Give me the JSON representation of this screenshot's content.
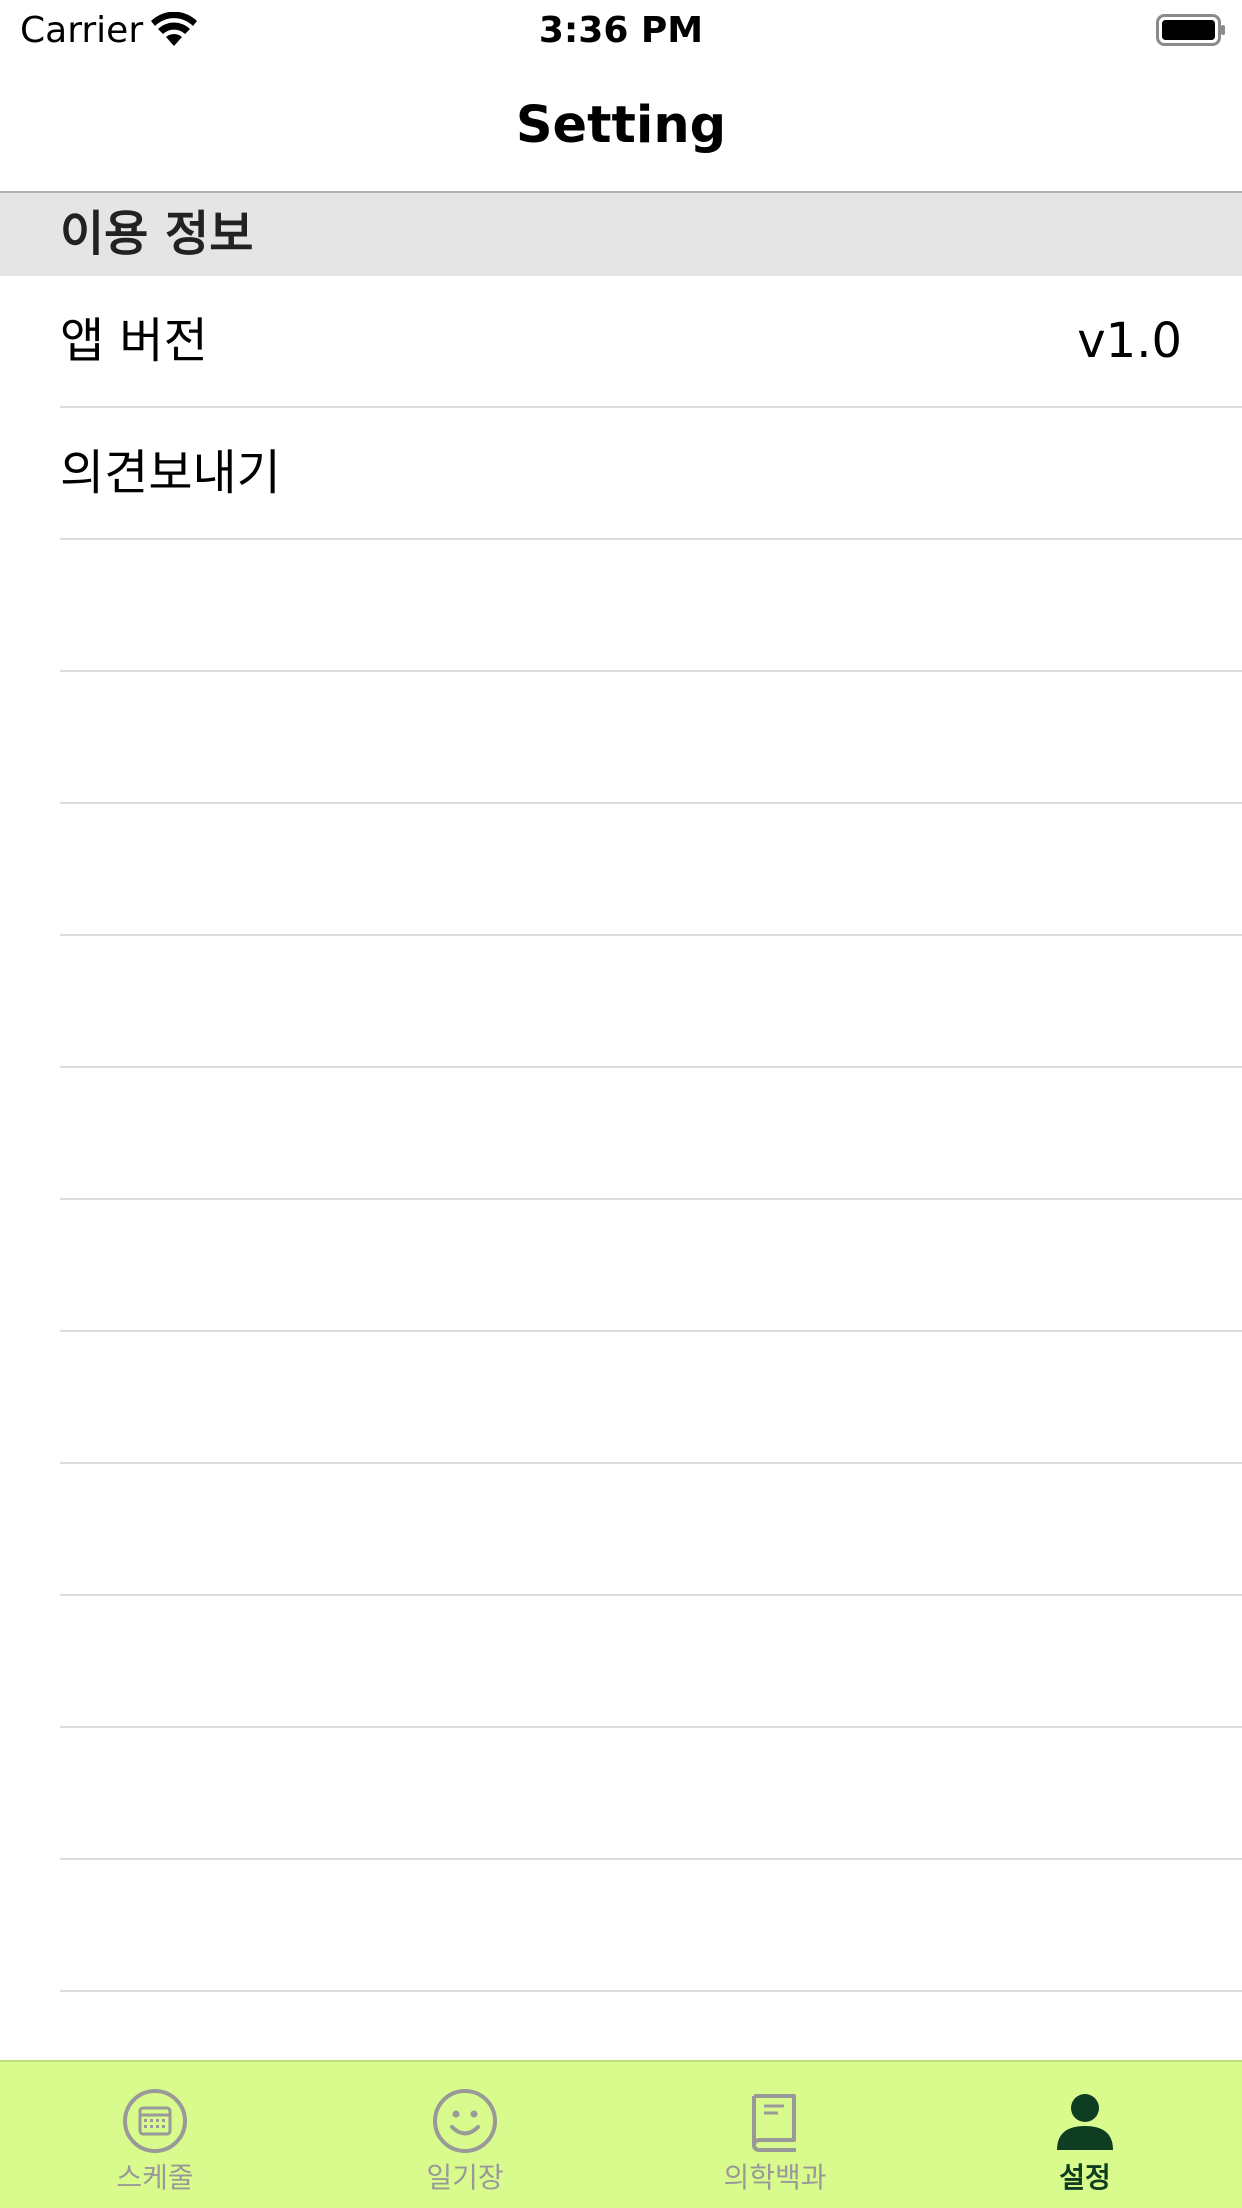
{
  "status_bar": {
    "carrier": "Carrier",
    "time": "3:36 PM"
  },
  "nav": {
    "title": "Setting"
  },
  "section": {
    "header": "이용 정보"
  },
  "rows": [
    {
      "label": "앱 버전",
      "detail": "v1.0"
    },
    {
      "label": "의견보내기",
      "detail": ""
    },
    {
      "label": "",
      "detail": ""
    },
    {
      "label": "",
      "detail": ""
    },
    {
      "label": "",
      "detail": ""
    },
    {
      "label": "",
      "detail": ""
    },
    {
      "label": "",
      "detail": ""
    },
    {
      "label": "",
      "detail": ""
    },
    {
      "label": "",
      "detail": ""
    },
    {
      "label": "",
      "detail": ""
    },
    {
      "label": "",
      "detail": ""
    },
    {
      "label": "",
      "detail": ""
    },
    {
      "label": "",
      "detail": ""
    },
    {
      "label": "",
      "detail": ""
    }
  ],
  "tab_bar": {
    "background": "#d9fa8c",
    "active_color": "#0f3d21",
    "inactive_color": "#999999",
    "tabs": [
      {
        "label": "스케줄",
        "icon": "calendar-icon",
        "active": false
      },
      {
        "label": "일기장",
        "icon": "smiley-icon",
        "active": false
      },
      {
        "label": "의학백과",
        "icon": "book-icon",
        "active": false
      },
      {
        "label": "설정",
        "icon": "person-icon",
        "active": true
      }
    ]
  }
}
